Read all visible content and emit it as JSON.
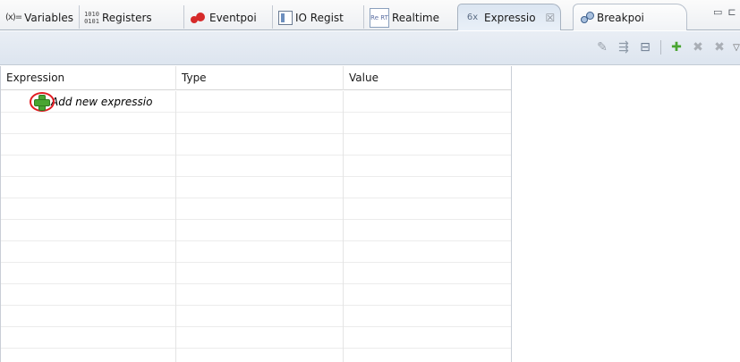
{
  "tabs": [
    {
      "label": "Variables",
      "icon": "variables-icon",
      "icon_text": "(x)="
    },
    {
      "label": "Registers",
      "icon": "registers-icon",
      "icon_text": "1010 0101"
    },
    {
      "label": "Eventpoi",
      "icon": "eventpoints-icon"
    },
    {
      "label": "IO Regist",
      "icon": "io-registers-icon"
    },
    {
      "label": "Realtime",
      "icon": "realtime-icon",
      "icon_text": "Re RT"
    },
    {
      "label": "Expressio",
      "icon": "expressions-icon",
      "icon_text": "6x",
      "active": true
    },
    {
      "label": "Breakpoi",
      "icon": "breakpoints-icon"
    }
  ],
  "colors": {
    "accent_ring": "#e11b22",
    "plus_green": "#4aa532",
    "tab_active_bg": "#dbe5f1"
  },
  "toolbar": {
    "icons": [
      "add-watch-expression-icon",
      "collapse-all-icon",
      "show-columns-icon",
      "add-expression-icon",
      "remove-expression-icon",
      "remove-all-expressions-icon",
      "view-menu-icon"
    ]
  },
  "table": {
    "columns": [
      "Expression",
      "Type",
      "Value"
    ],
    "add_row_label": "Add new expressio",
    "empty_rows": 12
  }
}
